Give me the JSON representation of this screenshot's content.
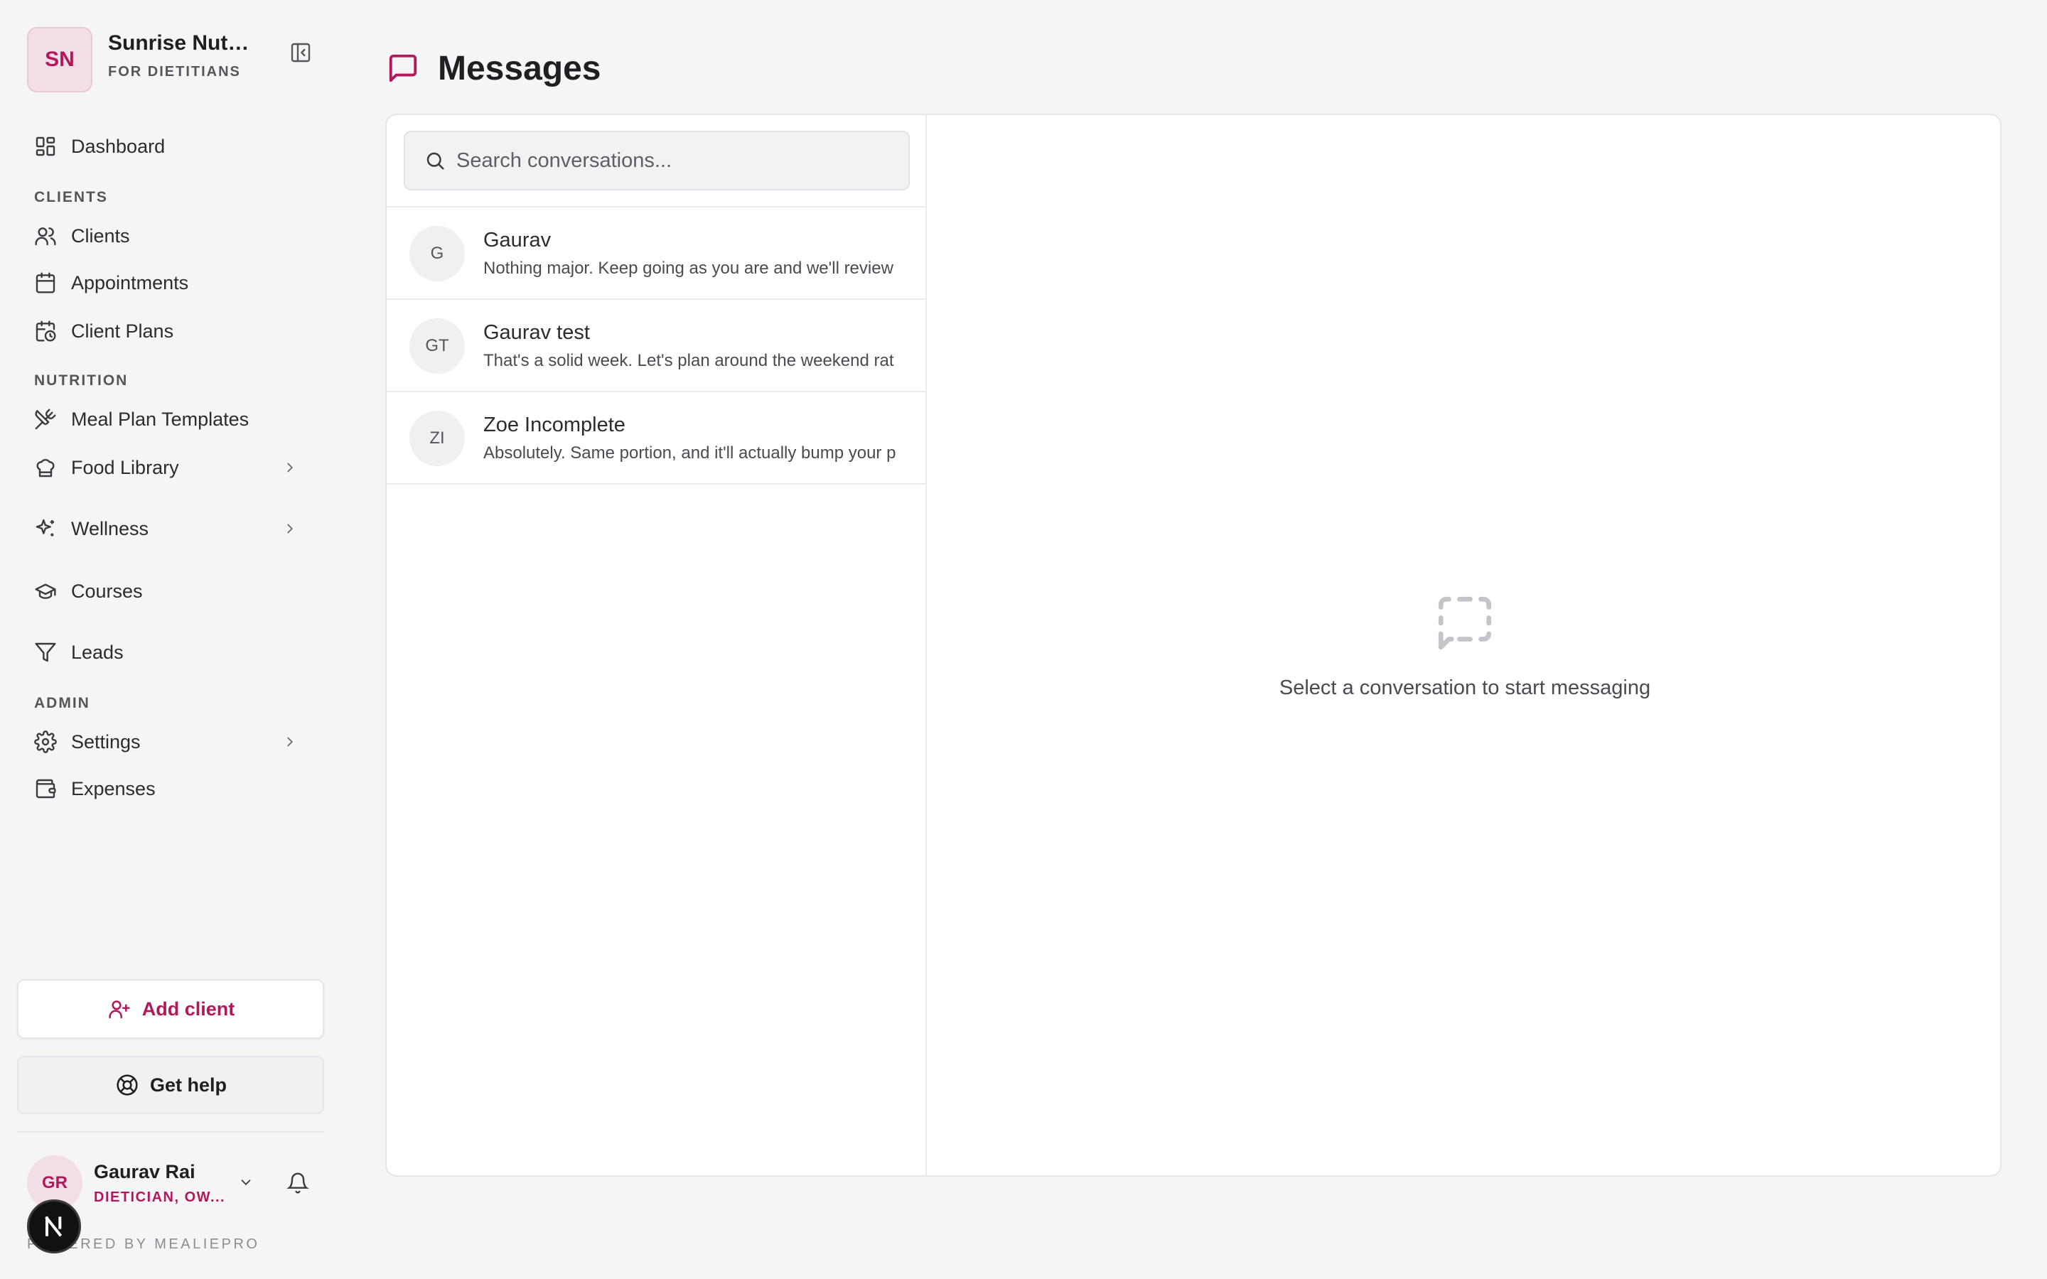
{
  "brand": {
    "initials": "SN",
    "name": "Sunrise Nutrition",
    "subtitle": "FOR DIETITIANS"
  },
  "nav": {
    "dashboard": "Dashboard",
    "section_clients": "CLIENTS",
    "clients": "Clients",
    "appointments": "Appointments",
    "client_plans": "Client Plans",
    "section_nutrition": "NUTRITION",
    "meal_plan_templates": "Meal Plan Templates",
    "food_library": "Food Library",
    "wellness": "Wellness",
    "courses": "Courses",
    "leads": "Leads",
    "section_admin": "ADMIN",
    "settings": "Settings",
    "expenses": "Expenses"
  },
  "actions": {
    "add_client": "Add client",
    "get_help": "Get help"
  },
  "user": {
    "initials": "GR",
    "name": "Gaurav Rai",
    "role": "DIETICIAN, OW..."
  },
  "footer": {
    "powered": "POWERED BY MEALIEPRO"
  },
  "page": {
    "title": "Messages"
  },
  "search": {
    "placeholder": "Search conversations..."
  },
  "conversations": [
    {
      "initials": "G",
      "name": "Gaurav",
      "preview": "Nothing major. Keep going as you are and we'll review"
    },
    {
      "initials": "GT",
      "name": "Gaurav test",
      "preview": "That's a solid week. Let's plan around the weekend rat"
    },
    {
      "initials": "ZI",
      "name": "Zoe Incomplete",
      "preview": "Absolutely. Same portion, and it'll actually bump your p"
    }
  ],
  "empty_state": {
    "text": "Select a conversation to start messaging"
  },
  "colors": {
    "accent": "#b3185a",
    "background": "#f5f5f6",
    "panel": "#ffffff"
  }
}
